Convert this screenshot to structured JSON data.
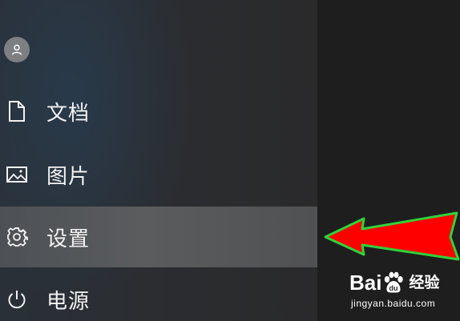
{
  "start_menu": {
    "user_avatar_icon": "person-icon",
    "items": [
      {
        "label": "文档",
        "icon": "document-icon"
      },
      {
        "label": "图片",
        "icon": "picture-icon"
      },
      {
        "label": "设置",
        "icon": "gear-icon",
        "highlighted": true
      },
      {
        "label": "电源",
        "icon": "power-icon"
      }
    ]
  },
  "annotation": {
    "arrow_color": "#ff0000",
    "arrow_outline_color": "#2fd23a"
  },
  "watermark": {
    "brand_bai": "Bai",
    "brand_du": "du",
    "brand_jingyan": "经验",
    "url": "jingyan.baidu.com"
  },
  "colors": {
    "menu_background": "#2b2d31",
    "highlight": "#55585b",
    "text": "#f2f2f2"
  }
}
